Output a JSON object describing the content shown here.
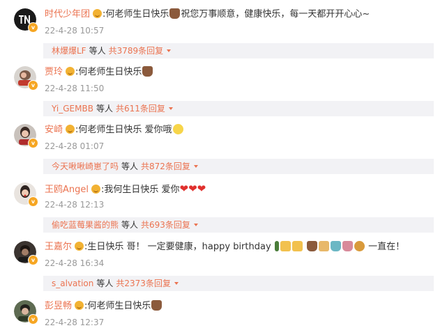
{
  "comments": [
    {
      "username": "时代少年团",
      "text": ":何老师生日快乐",
      "text_after": "祝您万事顺意，健康快乐，每一天都开开心心~",
      "emojis_mid": [
        "cake"
      ],
      "time": "22-4-28 10:57",
      "reply_user": "林爆爆LF",
      "reply_etc": "等人",
      "reply_count": "共3789条回复"
    },
    {
      "username": "贾玲",
      "text": ":何老师生日快乐",
      "text_after": "",
      "emojis_after": [
        "cake"
      ],
      "time": "22-4-28 11:50",
      "reply_user": "Yi_GEMBB",
      "reply_etc": "等人",
      "reply_count": "共611条回复"
    },
    {
      "username": "安崎",
      "text": ":何老师生日快乐 爱你哦",
      "text_after": "",
      "emojis_after": [
        "smile"
      ],
      "time": "22-4-28 01:07",
      "reply_user": "今天啾啾崎崽了吗",
      "reply_etc": "等人",
      "reply_count": "共872条回复"
    },
    {
      "username": "王鸥Angel",
      "text": ":我何生日快乐 爱你",
      "text_after": "",
      "emojis_after": [
        "heart",
        "heart",
        "heart"
      ],
      "time": "22-4-28 12:13",
      "reply_user": "偷吃蓝莓果酱的熊",
      "reply_etc": "等人",
      "reply_count": "共693条回复"
    },
    {
      "username": "王嘉尔",
      "text": ":生日快乐 哥！ 一定要健康，happy birthday",
      "text_after": "一直在！",
      "emojis_mid": [
        "bottle",
        "beer",
        "beer",
        "cake",
        "cake",
        "cupcake",
        "cupcake",
        "mooncake"
      ],
      "time": "22-4-28 16:34",
      "reply_user": "s_alvation",
      "reply_etc": "等人",
      "reply_count": "共2373条回复"
    },
    {
      "username": "彭昱畅",
      "text": ":何老师生日快乐",
      "text_after": "",
      "emojis_after": [
        "cake"
      ],
      "time": "22-4-28 12:37"
    }
  ],
  "colors": {
    "username": "#eb7350",
    "time": "#999999",
    "reply_bg": "#f2f2f5",
    "vip_badge": "#f6a623"
  },
  "icons": {
    "vip_badge": "v-badge-icon",
    "medal": "fan-medal-icon",
    "reply_toggle": "caret-down-icon"
  }
}
